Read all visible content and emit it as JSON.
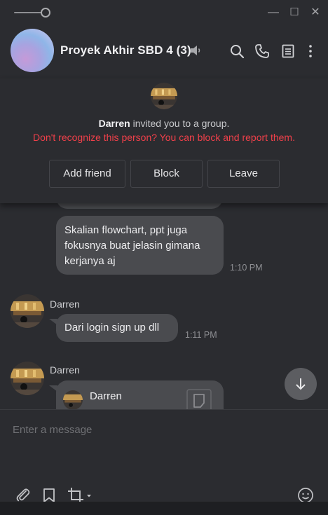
{
  "titlebar": {
    "minimize_glyph": "—",
    "maximize_glyph": "☐",
    "close_glyph": "✕"
  },
  "header": {
    "title": "Proyek Akhir SBD 4 (3)",
    "icons": [
      "search-icon",
      "phone-icon",
      "notes-icon",
      "more-icon"
    ]
  },
  "invitation": {
    "inviter": "Darren",
    "message": "invited you to a group.",
    "warning": "Don't recognize this person? You can block and report them.",
    "buttons": {
      "add_friend": "Add friend",
      "block": "Block",
      "leave": "Leave"
    }
  },
  "messages": [
    {
      "sender": "",
      "text": "Skalian flowchart, ppt juga fokusnya buat jelasin gimana kerjanya aj",
      "time": "1:10 PM"
    },
    {
      "sender": "Darren",
      "text": "Dari login sign up dll",
      "time": "1:11 PM"
    },
    {
      "sender": "Darren",
      "quoted_sender": "Darren",
      "quoted_preview": ""
    }
  ],
  "composer": {
    "placeholder": "Enter a message"
  },
  "colors": {
    "background": "#2b2c30",
    "bubble": "#4a4b4f",
    "warning": "#f0404a"
  }
}
